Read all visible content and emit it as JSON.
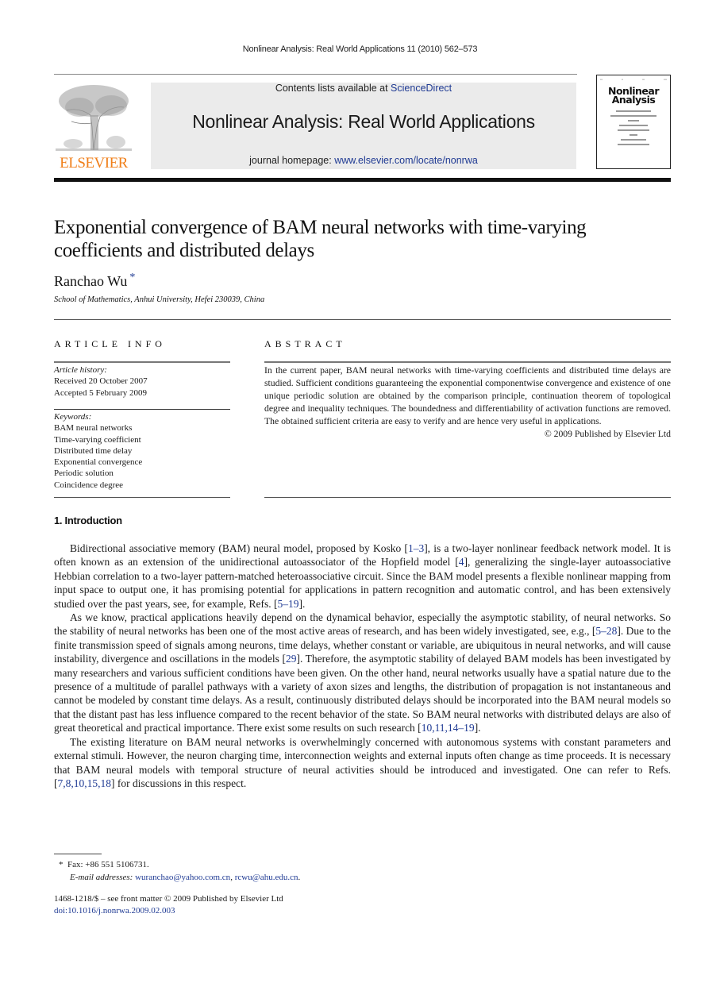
{
  "running_head": "Nonlinear Analysis: Real World Applications 11 (2010) 562–573",
  "publisher": {
    "wordmark": "ELSEVIER",
    "wordmark_color": "#f07f1a"
  },
  "journal_box": {
    "contents_prefix": "Contents lists available at ",
    "contents_link": "ScienceDirect",
    "journal_title": "Nonlinear Analysis: Real World Applications",
    "homepage_prefix": "journal homepage: ",
    "homepage_link": "www.elsevier.com/locate/nonrwa",
    "link_color": "#1f3a93"
  },
  "cover": {
    "title_line1": "Nonlinear",
    "title_line2": "Analysis"
  },
  "article": {
    "title": "Exponential convergence of BAM neural networks with time-varying coefficients and distributed delays",
    "author": "Ranchao Wu",
    "author_mark": "*",
    "affiliation": "School of Mathematics, Anhui University, Hefei 230039, China"
  },
  "article_info": {
    "heading": "ARTICLE INFO",
    "history_label": "Article history:",
    "received": "Received 20 October 2007",
    "accepted": "Accepted 5 February 2009",
    "keywords_label": "Keywords:",
    "keywords": [
      "BAM neural networks",
      "Time-varying coefficient",
      "Distributed time delay",
      "Exponential convergence",
      "Periodic solution",
      "Coincidence degree"
    ]
  },
  "abstract": {
    "heading": "ABSTRACT",
    "text": "In the current paper, BAM neural networks with time-varying coefficients and distributed time delays are studied. Sufficient conditions guaranteeing the exponential componentwise convergence and existence of one unique periodic solution are obtained by the comparison principle, continuation theorem of topological degree and inequality techniques. The boundedness and differentiability of activation functions are removed. The obtained sufficient criteria are easy to verify and are hence very useful in applications.",
    "copyright": "© 2009 Published by Elsevier Ltd"
  },
  "introduction": {
    "heading": "1.  Introduction",
    "p1": {
      "a": "Bidirectional associative memory (BAM) neural model, proposed by Kosko [",
      "ref1": "1–3",
      "b": "], is a two-layer nonlinear feedback network model. It is often known as an extension of the unidirectional autoassociator of the Hopfield model [",
      "ref2": "4",
      "c": "], generalizing the single-layer autoassociative Hebbian correlation to a two-layer pattern-matched heteroassociative circuit. Since the BAM model presents a flexible nonlinear mapping from input space to output one, it has promising potential for applications in pattern recognition and automatic control, and has been extensively studied over the past years, see, for example, Refs. [",
      "ref3": "5–19",
      "d": "]."
    },
    "p2": {
      "a": "As we know, practical applications heavily depend on the dynamical behavior, especially the asymptotic stability, of neural networks. So the stability of neural networks has been one of the most active areas of research, and has been widely investigated, see, e.g., [",
      "ref1": "5–28",
      "b": "]. Due to the finite transmission speed of signals among neurons, time delays, whether constant or variable, are ubiquitous in neural networks, and will cause instability, divergence and oscillations in the models [",
      "ref2": "29",
      "c": "]. Therefore, the asymptotic stability of delayed BAM models has been investigated by many researchers and various sufficient conditions have been given. On the other hand, neural networks usually have a spatial nature due to the presence of a multitude of parallel pathways with a variety of axon sizes and lengths, the distribution of propagation is not instantaneous and cannot be modeled by constant time delays. As a result, continuously distributed delays should be incorporated into the BAM neural models so that the distant past has less influence compared to the recent behavior of the state. So BAM neural networks with distributed delays are also of great theoretical and practical importance. There exist some results on such research [",
      "ref3": "10,11,14–19",
      "d": "]."
    },
    "p3": {
      "a": "The existing literature on BAM neural networks is overwhelmingly concerned with autonomous systems with constant parameters and external stimuli. However, the neuron charging time, interconnection weights and external inputs often change as time proceeds. It is necessary that BAM neural models with temporal structure of neural activities should be introduced and investigated. One can refer to Refs. [",
      "ref1": "7,8,10,15,18",
      "b": "] for discussions in this respect."
    }
  },
  "footnote": {
    "mark": "*",
    "fax": "Fax: +86 551 5106731.",
    "email_label": "E-mail addresses:",
    "email1": "wuranchao@yahoo.com.cn",
    "email2": "rcwu@ahu.edu.cn"
  },
  "front_matter": {
    "issn_line": "1468-1218/$ – see front matter © 2009 Published by Elsevier Ltd",
    "doi": "doi:10.1016/j.nonrwa.2009.02.003"
  }
}
